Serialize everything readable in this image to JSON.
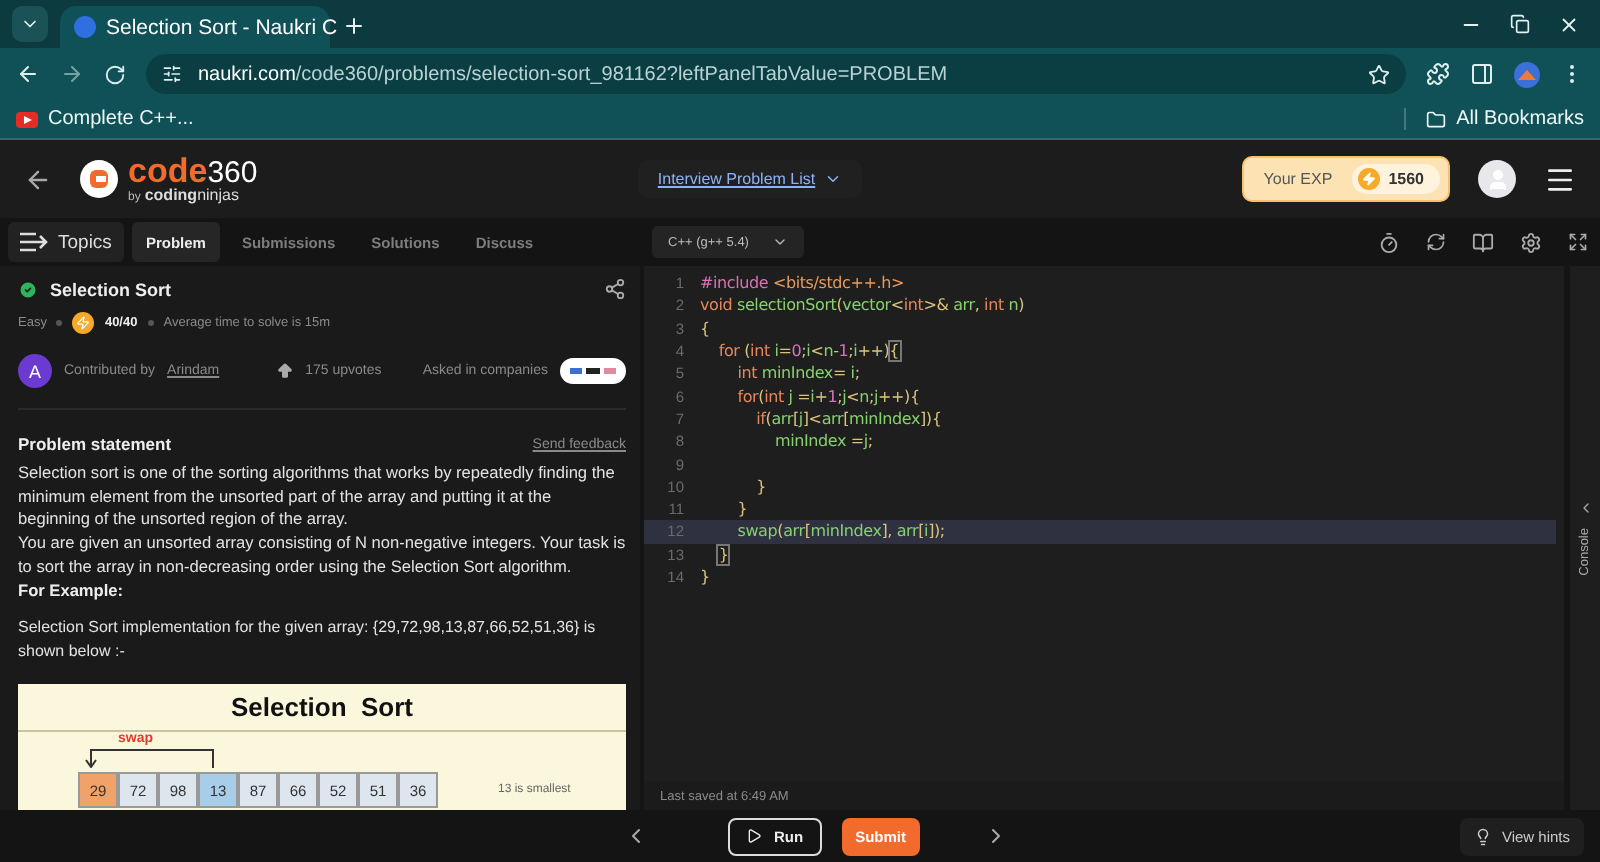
{
  "browser": {
    "tab_title": "Selection Sort - Naukri C",
    "url_host": "naukri.com",
    "url_path": "/code360/problems/selection-sort_981162?leftPanelTabValue=PROBLEM",
    "bookmarks": [
      {
        "label": "Complete C++..."
      }
    ],
    "all_bookmarks": "All Bookmarks"
  },
  "header": {
    "logo_word": "code",
    "logo_number": "360",
    "logo_by": "by",
    "logo_brand": "**coding**ninjas",
    "interview_link": "Interview Problem List",
    "exp_label": "Your EXP",
    "exp_value": "1560"
  },
  "topics": "Topics",
  "tabs": [
    {
      "label": "Problem",
      "selected": true
    },
    {
      "label": "Submissions",
      "selected": false
    },
    {
      "label": "Solutions",
      "selected": false
    },
    {
      "label": "Discuss",
      "selected": false
    }
  ],
  "language": "C++ (g++ 5.4)",
  "problem": {
    "title": "Selection Sort",
    "solved": true,
    "difficulty": "Easy",
    "score": "40/40",
    "avg_time": "Average time to solve is 15m",
    "avatar": "A",
    "contributed_by": "Contributed by",
    "author": "Arindam",
    "upvotes": "175 upvotes",
    "asked_in": "Asked in companies",
    "statement_heading": "Problem statement",
    "feedback": "Send feedback",
    "paragraphs": [
      "Selection sort is one of the sorting algorithms that works by repeatedly finding the minimum element from the unsorted part of the array and putting it at the beginning of the unsorted region of the array.",
      "You are given an unsorted array consisting of N non-negative integers. Your task is to sort the array in non-decreasing order using the Selection Sort algorithm."
    ],
    "example_heading": "For Example:",
    "example_text": "Selection Sort implementation for the given array:  {29,72,98,13,87,66,52,51,36} is shown below :-",
    "figure": {
      "title": "Selection  Sort",
      "swap_label": "swap",
      "cells": [
        {
          "text": "29",
          "color": "#f0a268"
        },
        {
          "text": "72",
          "color": "#dde6ef"
        },
        {
          "text": "98",
          "color": "#dde6ef"
        },
        {
          "text": "13",
          "color": "#a8cde8"
        },
        {
          "text": "87",
          "color": "#dde6ef"
        },
        {
          "text": "66",
          "color": "#dde6ef"
        },
        {
          "text": "52",
          "color": "#dde6ef"
        },
        {
          "text": "51",
          "color": "#dde6ef"
        },
        {
          "text": "36",
          "color": "#dde6ef"
        }
      ],
      "note": "13 is smallest"
    }
  },
  "code_lines": [
    {
      "number": "1",
      "current": false,
      "tokens": [
        {
          "kind": "pre",
          "text": "#include "
        },
        {
          "kind": "str",
          "text": "<bits/stdc++.h>"
        }
      ]
    },
    {
      "number": "2",
      "current": false,
      "tokens": [
        {
          "kind": "kw",
          "text": "void "
        },
        {
          "kind": "id",
          "text": "selectionSort"
        },
        {
          "kind": "p",
          "text": "("
        },
        {
          "kind": "id",
          "text": "vector"
        },
        {
          "kind": "p",
          "text": "<"
        },
        {
          "kind": "kw",
          "text": "int"
        },
        {
          "kind": "p",
          "text": ">& "
        },
        {
          "kind": "id",
          "text": "arr"
        },
        {
          "kind": "p",
          "text": ", "
        },
        {
          "kind": "kw",
          "text": "int "
        },
        {
          "kind": "id",
          "text": "n"
        },
        {
          "kind": "p",
          "text": ")"
        }
      ]
    },
    {
      "number": "3",
      "current": false,
      "tokens": [
        {
          "kind": "p",
          "text": "{"
        }
      ]
    },
    {
      "number": "4",
      "current": false,
      "tokens": [
        {
          "kind": "kw",
          "text": "    for "
        },
        {
          "kind": "p",
          "text": "("
        },
        {
          "kind": "kw",
          "text": "int "
        },
        {
          "kind": "id",
          "text": "i"
        },
        {
          "kind": "p",
          "text": "="
        },
        {
          "kind": "num",
          "text": "0"
        },
        {
          "kind": "p",
          "text": ";"
        },
        {
          "kind": "id",
          "text": "i"
        },
        {
          "kind": "p",
          "text": "<"
        },
        {
          "kind": "id",
          "text": "n"
        },
        {
          "kind": "p",
          "text": "-"
        },
        {
          "kind": "num",
          "text": "1"
        },
        {
          "kind": "p",
          "text": ";"
        },
        {
          "kind": "id",
          "text": "i"
        },
        {
          "kind": "p",
          "text": "++)"
        },
        {
          "kind": "match",
          "text": "{"
        }
      ]
    },
    {
      "number": "5",
      "current": false,
      "tokens": [
        {
          "kind": "kw",
          "text": "        int "
        },
        {
          "kind": "id",
          "text": "minIndex"
        },
        {
          "kind": "p",
          "text": "= "
        },
        {
          "kind": "id",
          "text": "i"
        },
        {
          "kind": "p",
          "text": ";"
        }
      ]
    },
    {
      "number": "6",
      "current": false,
      "tokens": [
        {
          "kind": "kw",
          "text": "        for"
        },
        {
          "kind": "p",
          "text": "("
        },
        {
          "kind": "kw",
          "text": "int "
        },
        {
          "kind": "id",
          "text": "j "
        },
        {
          "kind": "p",
          "text": "="
        },
        {
          "kind": "id",
          "text": "i"
        },
        {
          "kind": "p",
          "text": "+"
        },
        {
          "kind": "num",
          "text": "1"
        },
        {
          "kind": "p",
          "text": ";"
        },
        {
          "kind": "id",
          "text": "j"
        },
        {
          "kind": "p",
          "text": "<"
        },
        {
          "kind": "id",
          "text": "n"
        },
        {
          "kind": "p",
          "text": ";"
        },
        {
          "kind": "id",
          "text": "j"
        },
        {
          "kind": "p",
          "text": "++){"
        }
      ]
    },
    {
      "number": "7",
      "current": false,
      "tokens": [
        {
          "kind": "kw",
          "text": "            if"
        },
        {
          "kind": "p",
          "text": "("
        },
        {
          "kind": "id",
          "text": "arr"
        },
        {
          "kind": "p",
          "text": "["
        },
        {
          "kind": "id",
          "text": "j"
        },
        {
          "kind": "p",
          "text": "]<"
        },
        {
          "kind": "id",
          "text": "arr"
        },
        {
          "kind": "p",
          "text": "["
        },
        {
          "kind": "id",
          "text": "minIndex"
        },
        {
          "kind": "p",
          "text": "]){"
        }
      ]
    },
    {
      "number": "8",
      "current": false,
      "tokens": [
        {
          "kind": "id",
          "text": "                minIndex "
        },
        {
          "kind": "p",
          "text": "="
        },
        {
          "kind": "id",
          "text": "j"
        },
        {
          "kind": "p",
          "text": ";"
        }
      ]
    },
    {
      "number": "9",
      "current": false
    },
    {
      "number": "10",
      "current": false,
      "tokens": [
        {
          "kind": "p",
          "text": "            }"
        }
      ]
    },
    {
      "number": "11",
      "current": false,
      "tokens": [
        {
          "kind": "p",
          "text": "        }"
        }
      ]
    },
    {
      "number": "12",
      "current": true,
      "tokens": [
        {
          "kind": "id",
          "text": "        swap"
        },
        {
          "kind": "p",
          "text": "("
        },
        {
          "kind": "id",
          "text": "arr"
        },
        {
          "kind": "p",
          "text": "["
        },
        {
          "kind": "id",
          "text": "minIndex"
        },
        {
          "kind": "p",
          "text": "], "
        },
        {
          "kind": "id",
          "text": "arr"
        },
        {
          "kind": "p",
          "text": "["
        },
        {
          "kind": "id",
          "text": "i"
        },
        {
          "kind": "p",
          "text": "]);"
        }
      ]
    },
    {
      "number": "13",
      "current": false,
      "tokens": [
        {
          "kind": "match",
          "text": "    }"
        }
      ]
    },
    {
      "number": "14",
      "current": false,
      "tokens": [
        {
          "kind": "p",
          "text": "}"
        }
      ]
    }
  ],
  "last_saved": "Last saved at 6:49 AM",
  "console": "Console",
  "run": "Run",
  "submit": "Submit",
  "view_hints": "View hints"
}
